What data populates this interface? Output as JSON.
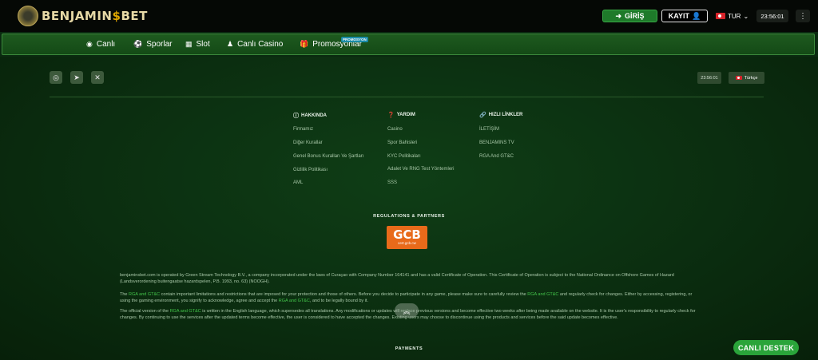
{
  "header": {
    "logo_text_1": "BENJAMIN",
    "logo_dollar": "$",
    "logo_text_2": "BET",
    "login_label": "GİRİŞ",
    "register_label": "KAYIT",
    "language_code": "TUR",
    "time": "23:56:01"
  },
  "nav": {
    "items": [
      {
        "label": "Canlı",
        "icon": "live-icon"
      },
      {
        "label": "Sporlar",
        "icon": "football-icon"
      },
      {
        "label": "Slot",
        "icon": "slot-icon"
      },
      {
        "label": "Canlı Casino",
        "icon": "dealer-icon"
      },
      {
        "label": "Promosyonlar",
        "icon": "gift-icon"
      }
    ],
    "promo_badge": "PROMOSYON"
  },
  "footer_top": {
    "socials": [
      "instagram-icon",
      "telegram-icon",
      "x-icon"
    ],
    "time": "23:56:01",
    "language": "Türkçe"
  },
  "columns": {
    "about": {
      "title": "HAKKINDA",
      "links": [
        "Firmamız",
        "Diğer Kurallar",
        "Genel Bonus Kuralları Ve Şartları",
        "Gizlilik Politikası",
        "AML"
      ]
    },
    "help": {
      "title": "YARDIM",
      "links": [
        "Casino",
        "Spor Bahisleri",
        "KYC Politikaları",
        "Adalet Ve RNG Test Yöntemleri",
        "SSS"
      ]
    },
    "quick": {
      "title": "HIZLI LİNKLER",
      "links": [
        "İLETİŞİM",
        "BENJAMINS TV",
        "RGA And GT&C"
      ]
    }
  },
  "regulations": {
    "title": "REGULATIONS & PARTNERS",
    "gcb_main": "GCB",
    "gcb_sub": "cert.gcb.cw"
  },
  "legal": {
    "p1": "benjaminsbet.com is operated by Green Stream Technology B.V., a company incorporated under the laws of Curaçao with Company Number 164141 and has a valid Certificate of Operation. This Certificate of Operation is subject to the National Ordinance on Offshore Games of Hazard (Landsverordening buitengaatse hazardspelen, P.B. 1993, no. 63) (NOOGH).",
    "p2_a": "The ",
    "p2_link1": "RGA and GT&C",
    "p2_b": " contain important limitations and restrictions that are imposed for your protection and those of others. Before you decide to participate in any game, please make sure to carefully review the ",
    "p2_link2": "RGA and GT&C",
    "p2_c": " and regularly check for changes. Either by accessing, registering, or using the gaming environment, you signify to acknowledge, agree and accept the ",
    "p2_link3": "RGA and GT&C",
    "p2_d": ", and to be legally bound by it.",
    "p3_a": "The official version of the ",
    "p3_link": "RGA and GT&C",
    "p3_b": " is written in the English language, which supersedes all translations. Any modifications or updates will replace previous versions and become effective two weeks after being made available on the website. It is the user's responsibility to regularly check for changes. By continuing to use the services after the updated terms become effective, the user is considered to have accepted the changes. Existing users may choose to discontinue using the products and services before the said update becomes effective."
  },
  "payments_title": "PAYMENTS",
  "live_support_label": "CANLI DESTEK",
  "colors": {
    "accent_green": "#2aa43a",
    "link_green": "#43c44a",
    "gcb_orange": "#e86a1a"
  }
}
